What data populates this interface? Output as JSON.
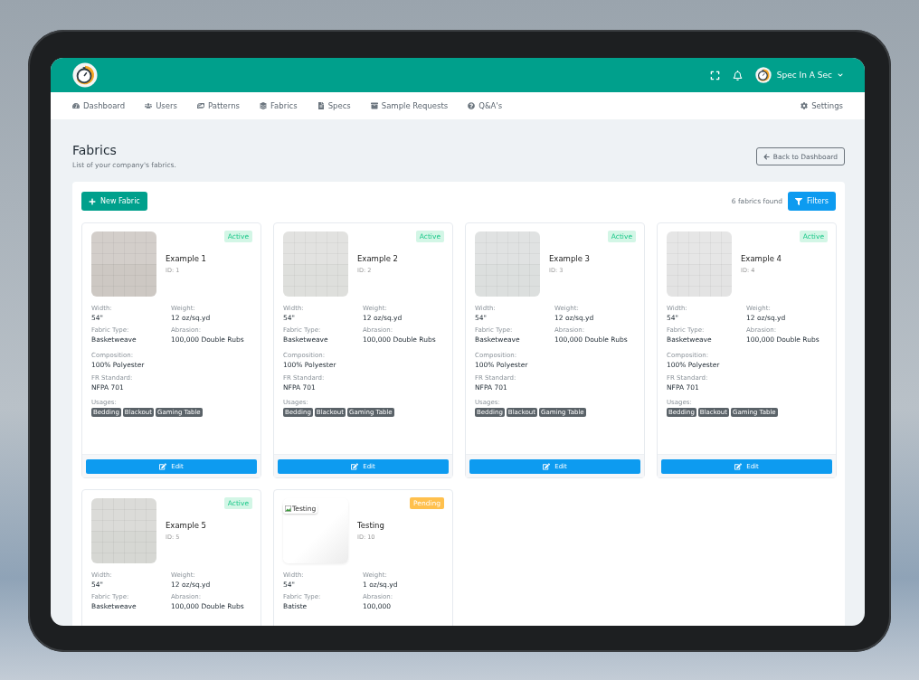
{
  "header": {
    "user_name": "Spec In A Sec"
  },
  "nav": {
    "items": [
      {
        "label": "Dashboard"
      },
      {
        "label": "Users"
      },
      {
        "label": "Patterns"
      },
      {
        "label": "Fabrics"
      },
      {
        "label": "Specs"
      },
      {
        "label": "Sample Requests"
      },
      {
        "label": "Q&A's"
      }
    ],
    "settings": "Settings"
  },
  "page": {
    "title": "Fabrics",
    "subtitle": "List of your company's fabrics.",
    "back_button": "Back to Dashboard"
  },
  "toolbar": {
    "new_button": "New Fabric",
    "count": "6 fabrics found",
    "filters_button": "Filters"
  },
  "cards": [
    {
      "name": "Example 1",
      "id": "ID: 1",
      "status": {
        "label": "Active",
        "kind": "active"
      },
      "image": {
        "kind": "picture"
      },
      "specs": [
        {
          "label": "Width:",
          "value": "54\""
        },
        {
          "label": "Weight:",
          "value": "12 oz/sq.yd"
        },
        {
          "label": "Fabric Type:",
          "value": "Basketweave"
        },
        {
          "label": "Abrasion:",
          "value": "100,000 Double Rubs"
        }
      ],
      "details": [
        {
          "label": "Composition:",
          "value": "100% Polyester"
        },
        {
          "label": "FR Standard:",
          "value": "NFPA 701"
        }
      ],
      "usages_label": "Usages:",
      "usages": [
        "Bedding",
        "Blackout",
        "Gaming Table"
      ],
      "edit": "Edit"
    },
    {
      "name": "Example 2",
      "id": "ID: 2",
      "status": {
        "label": "Active",
        "kind": "active"
      },
      "image": {
        "kind": "picture"
      },
      "specs": [
        {
          "label": "Width:",
          "value": "54\""
        },
        {
          "label": "Weight:",
          "value": "12 oz/sq.yd"
        },
        {
          "label": "Fabric Type:",
          "value": "Basketweave"
        },
        {
          "label": "Abrasion:",
          "value": "100,000 Double Rubs"
        }
      ],
      "details": [
        {
          "label": "Composition:",
          "value": "100% Polyester"
        },
        {
          "label": "FR Standard:",
          "value": "NFPA 701"
        }
      ],
      "usages_label": "Usages:",
      "usages": [
        "Bedding",
        "Blackout",
        "Gaming Table"
      ],
      "edit": "Edit"
    },
    {
      "name": "Example 3",
      "id": "ID: 3",
      "status": {
        "label": "Active",
        "kind": "active"
      },
      "image": {
        "kind": "picture"
      },
      "specs": [
        {
          "label": "Width:",
          "value": "54\""
        },
        {
          "label": "Weight:",
          "value": "12 oz/sq.yd"
        },
        {
          "label": "Fabric Type:",
          "value": "Basketweave"
        },
        {
          "label": "Abrasion:",
          "value": "100,000 Double Rubs"
        }
      ],
      "details": [
        {
          "label": "Composition:",
          "value": "100% Polyester"
        },
        {
          "label": "FR Standard:",
          "value": "NFPA 701"
        }
      ],
      "usages_label": "Usages:",
      "usages": [
        "Bedding",
        "Blackout",
        "Gaming Table"
      ],
      "edit": "Edit"
    },
    {
      "name": "Example 4",
      "id": "ID: 4",
      "status": {
        "label": "Active",
        "kind": "active"
      },
      "image": {
        "kind": "picture"
      },
      "specs": [
        {
          "label": "Width:",
          "value": "54\""
        },
        {
          "label": "Weight:",
          "value": "12 oz/sq.yd"
        },
        {
          "label": "Fabric Type:",
          "value": "Basketweave"
        },
        {
          "label": "Abrasion:",
          "value": "100,000 Double Rubs"
        }
      ],
      "details": [
        {
          "label": "Composition:",
          "value": "100% Polyester"
        },
        {
          "label": "FR Standard:",
          "value": "NFPA 701"
        }
      ],
      "usages_label": "Usages:",
      "usages": [
        "Bedding",
        "Blackout",
        "Gaming Table"
      ],
      "edit": "Edit"
    },
    {
      "name": "Example 5",
      "id": "ID: 5",
      "status": {
        "label": "Active",
        "kind": "active"
      },
      "image": {
        "kind": "picture"
      },
      "specs": [
        {
          "label": "Width:",
          "value": "54\""
        },
        {
          "label": "Weight:",
          "value": "12 oz/sq.yd"
        },
        {
          "label": "Fabric Type:",
          "value": "Basketweave"
        },
        {
          "label": "Abrasion:",
          "value": "100,000 Double Rubs"
        }
      ]
    },
    {
      "name": "Testing",
      "id": "ID: 10",
      "status": {
        "label": "Pending",
        "kind": "pending"
      },
      "image": {
        "kind": "broken",
        "alt": "Testing"
      },
      "specs": [
        {
          "label": "Width:",
          "value": "54\""
        },
        {
          "label": "Weight:",
          "value": "1 oz/sq.yd"
        },
        {
          "label": "Fabric Type:",
          "value": "Batiste"
        },
        {
          "label": "Abrasion:",
          "value": "100,000"
        }
      ]
    }
  ]
}
